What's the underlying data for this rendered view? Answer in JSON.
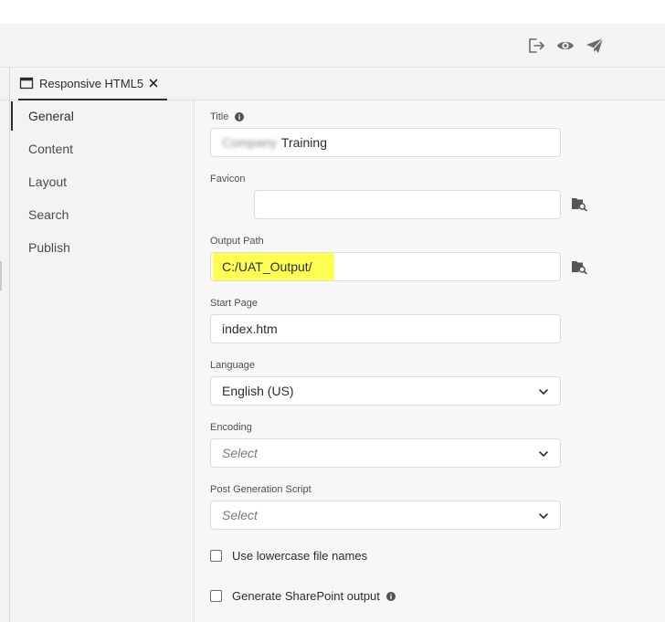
{
  "toolbar": {
    "icons": [
      "export-icon",
      "eye-icon",
      "send-icon"
    ]
  },
  "tab": {
    "label": "Responsive HTML5"
  },
  "sidebar": {
    "items": [
      {
        "label": "General",
        "active": true
      },
      {
        "label": "Content",
        "active": false
      },
      {
        "label": "Layout",
        "active": false
      },
      {
        "label": "Search",
        "active": false
      },
      {
        "label": "Publish",
        "active": false
      }
    ]
  },
  "form": {
    "title": {
      "label": "Title",
      "blurred_prefix": "Company",
      "value": "Training"
    },
    "favicon": {
      "label": "Favicon",
      "value": ""
    },
    "output_path": {
      "label": "Output Path",
      "value": "C:/UAT_Output/"
    },
    "start_page": {
      "label": "Start Page",
      "value": "index.htm"
    },
    "language": {
      "label": "Language",
      "value": "English (US)"
    },
    "encoding": {
      "label": "Encoding",
      "placeholder": "Select"
    },
    "post_script": {
      "label": "Post Generation Script",
      "placeholder": "Select"
    },
    "lowercase": {
      "label": "Use lowercase file names",
      "checked": false
    },
    "sharepoint": {
      "label": "Generate SharePoint output",
      "checked": false
    }
  },
  "colors": {
    "highlight": "#ffff33",
    "panel_bg": "#f3f3f3",
    "accent": "#2c2c2c"
  }
}
